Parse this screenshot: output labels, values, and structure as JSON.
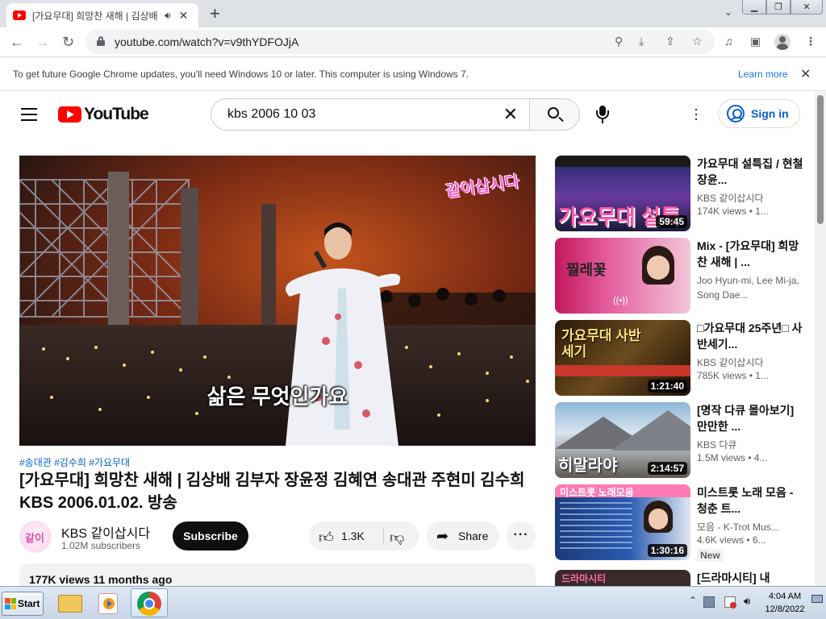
{
  "browser": {
    "tab_title": "[가요무대] 희망찬 새해 | 김상배",
    "url": "youtube.com/watch?v=v9thYDFOJjA",
    "infobar_text": "To get future Google Chrome updates, you'll need Windows 10 or later. This computer is using Windows 7.",
    "infobar_link": "Learn more"
  },
  "youtube": {
    "logo_text": "YouTube",
    "search_value": "kbs 2006 10 03",
    "signin_label": "Sign in"
  },
  "player": {
    "subtitle": "삶은 무엇인가요",
    "watermark": "같이삽시다"
  },
  "video": {
    "hashtags": "#송대관 #김수희 #가요무대",
    "title": "[가요무대] 희망찬 새해 | 김상배 김부자 장윤정 김혜연 송대관 주현미 김수희 KBS 2006.01.02. 방송",
    "channel_name": "KBS 같이삽시다",
    "subscribers": "1.02M subscribers",
    "subscribe_label": "Subscribe",
    "likes": "1.3K",
    "share_label": "Share",
    "views_date": "177K views  11 months ago"
  },
  "recommendations": [
    {
      "title": "가요무대 설특집 / 현철 장윤...",
      "channel": "KBS 같이삽시다",
      "views": "174K views  • 1...",
      "duration": "59:45",
      "thumb_text": "가요무대 설특"
    },
    {
      "title": "Mix - [가요무대] 희망찬 새해 | ...",
      "channel": "Joo Hyun-mi, Lee Mi-ja, Song Dae...",
      "views": "",
      "duration": "",
      "thumb_text": "찔레꽃"
    },
    {
      "title": "□가요무대 25주년□ 사반세기...",
      "channel": "KBS 같이삽시다",
      "views": "785K views  • 1...",
      "duration": "1:21:40",
      "thumb_text": "가요무대 사반세기"
    },
    {
      "title": "[명작 다큐 몰아보기] 만만한 ...",
      "channel": "KBS 다큐",
      "views": "1.5M views  • 4...",
      "duration": "2:14:57",
      "thumb_text": "히말라야"
    },
    {
      "title": "미스트롯 노래 모음 - 청춘 트...",
      "channel": "모음 - K-Trot Mus...",
      "views": "4.6K views  • 6...",
      "duration": "1:30:16",
      "thumb_text": "미스트롯 노래모음",
      "badge": "New"
    },
    {
      "title": "[드라마시티] 내",
      "channel": "",
      "views": "",
      "duration": "",
      "thumb_text": "드라마시티"
    }
  ],
  "taskbar": {
    "start_label": "Start",
    "time": "4:04 AM",
    "date": "12/8/2022"
  },
  "colors": {
    "youtube_red": "#ff0000",
    "link_blue": "#065fd4",
    "chrome_tabstrip": "#dee1e6"
  }
}
